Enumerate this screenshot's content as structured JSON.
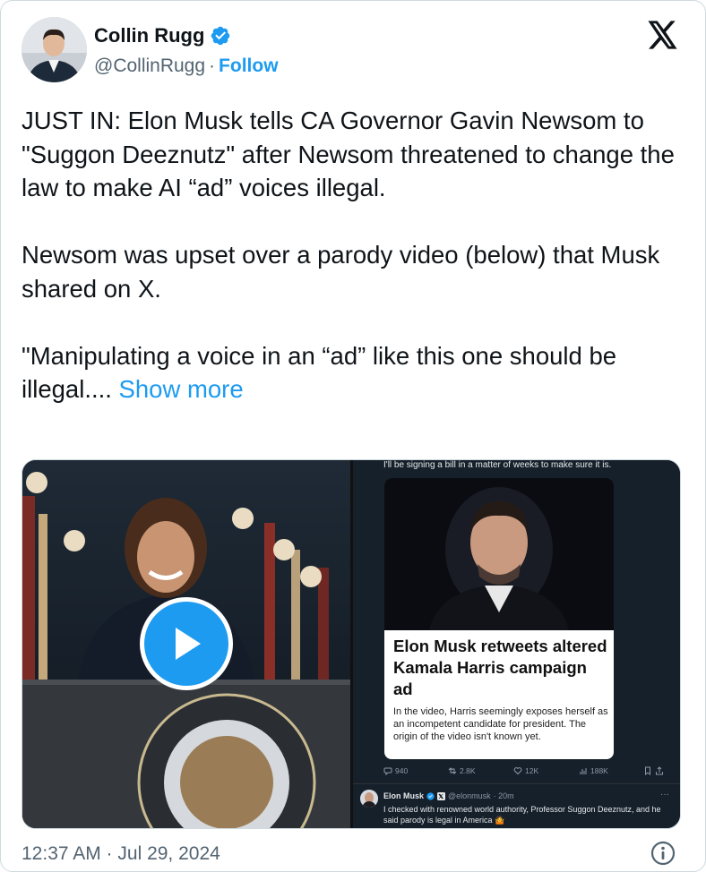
{
  "author": {
    "name": "Collin Rugg",
    "handle": "@CollinRugg",
    "separator": "·",
    "follow_label": "Follow",
    "verified_icon": "verified-badge-icon"
  },
  "brand": {
    "logo": "x-logo-icon",
    "accent": "#1d9bf0"
  },
  "tweet": {
    "paragraphs": [
      "JUST IN: Elon Musk tells CA Governor Gavin Newsom to \"Suggon Deeznutz\" after Newsom threatened to change the law to make AI “ad” voices illegal.",
      "Newsom was upset over a parody video (below) that Musk shared on X.",
      "\"Manipulating a voice in an “ad” like this one should be illegal...."
    ],
    "show_more": "Show more"
  },
  "media": {
    "video_play_icon": "play-icon",
    "screenshot": {
      "top_text": "I'll be signing a bill in a matter of weeks to make sure it is.",
      "headline": "Elon Musk retweets altered Kamala Harris campaign ad",
      "summary": "In the video, Harris seemingly exposes herself as an incompetent candidate for president. The origin of the video isn't known yet.",
      "stats": {
        "replies": "940",
        "reposts": "2.8K",
        "likes": "12K",
        "views": "188K"
      },
      "reply": {
        "name": "Elon Musk",
        "handle": "@elonmusk",
        "time": "· 20m",
        "more": "···",
        "text": "I checked with renowned world authority, Professor Suggon Deeznutz, and he said parody is legal in America 🤷"
      }
    }
  },
  "footer": {
    "timestamp": "12:37 AM · Jul 29, 2024",
    "info_icon": "info-icon"
  }
}
